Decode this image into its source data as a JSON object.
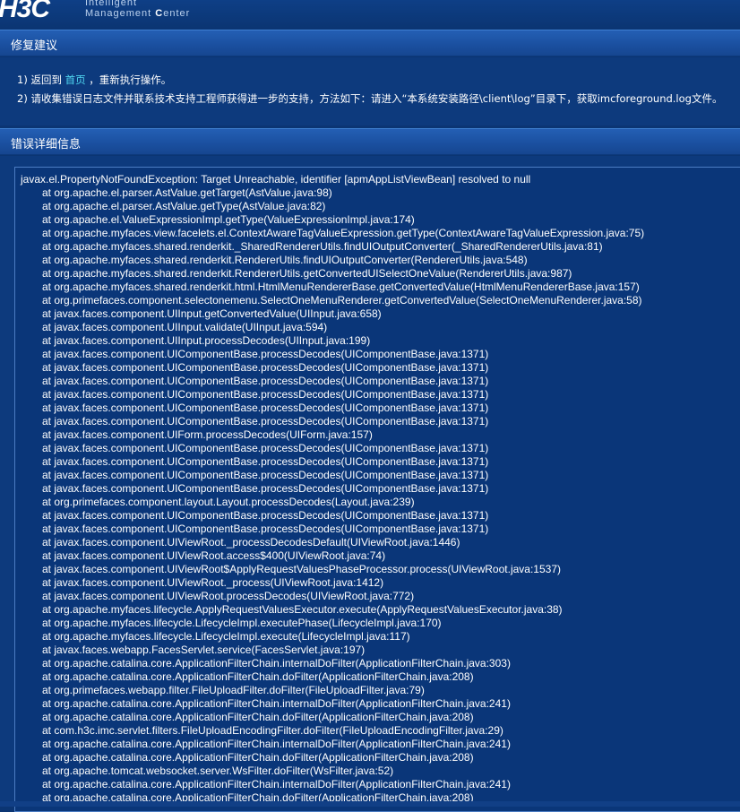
{
  "header": {
    "logo": "H3C",
    "product_line1": "Intelligent",
    "product_line2_prefix": "Management ",
    "product_line2_accent": "C",
    "product_line2_suffix": "enter"
  },
  "suggestion": {
    "title": "修复建议",
    "item1_prefix": "1)   返回到 ",
    "item1_link": "首页",
    "item1_suffix": " ，重新执行操作。",
    "item2": "2)   请收集错误日志文件并联系技术支持工程师获得进一步的支持，方法如下：请进入“本系统安装路径\\client\\log”目录下，获取imcforeground.log文件。"
  },
  "detail": {
    "title": "错误详细信息",
    "exception": "javax.el.PropertyNotFoundException: Target Unreachable, identifier [apmAppListViewBean] resolved to null",
    "frames": [
      "at org.apache.el.parser.AstValue.getTarget(AstValue.java:98)",
      "at org.apache.el.parser.AstValue.getType(AstValue.java:82)",
      "at org.apache.el.ValueExpressionImpl.getType(ValueExpressionImpl.java:174)",
      "at org.apache.myfaces.view.facelets.el.ContextAwareTagValueExpression.getType(ContextAwareTagValueExpression.java:75)",
      "at org.apache.myfaces.shared.renderkit._SharedRendererUtils.findUIOutputConverter(_SharedRendererUtils.java:81)",
      "at org.apache.myfaces.shared.renderkit.RendererUtils.findUIOutputConverter(RendererUtils.java:548)",
      "at org.apache.myfaces.shared.renderkit.RendererUtils.getConvertedUISelectOneValue(RendererUtils.java:987)",
      "at org.apache.myfaces.shared.renderkit.html.HtmlMenuRendererBase.getConvertedValue(HtmlMenuRendererBase.java:157)",
      "at org.primefaces.component.selectonemenu.SelectOneMenuRenderer.getConvertedValue(SelectOneMenuRenderer.java:58)",
      "at javax.faces.component.UIInput.getConvertedValue(UIInput.java:658)",
      "at javax.faces.component.UIInput.validate(UIInput.java:594)",
      "at javax.faces.component.UIInput.processDecodes(UIInput.java:199)",
      "at javax.faces.component.UIComponentBase.processDecodes(UIComponentBase.java:1371)",
      "at javax.faces.component.UIComponentBase.processDecodes(UIComponentBase.java:1371)",
      "at javax.faces.component.UIComponentBase.processDecodes(UIComponentBase.java:1371)",
      "at javax.faces.component.UIComponentBase.processDecodes(UIComponentBase.java:1371)",
      "at javax.faces.component.UIComponentBase.processDecodes(UIComponentBase.java:1371)",
      "at javax.faces.component.UIComponentBase.processDecodes(UIComponentBase.java:1371)",
      "at javax.faces.component.UIForm.processDecodes(UIForm.java:157)",
      "at javax.faces.component.UIComponentBase.processDecodes(UIComponentBase.java:1371)",
      "at javax.faces.component.UIComponentBase.processDecodes(UIComponentBase.java:1371)",
      "at javax.faces.component.UIComponentBase.processDecodes(UIComponentBase.java:1371)",
      "at javax.faces.component.UIComponentBase.processDecodes(UIComponentBase.java:1371)",
      "at org.primefaces.component.layout.Layout.processDecodes(Layout.java:239)",
      "at javax.faces.component.UIComponentBase.processDecodes(UIComponentBase.java:1371)",
      "at javax.faces.component.UIComponentBase.processDecodes(UIComponentBase.java:1371)",
      "at javax.faces.component.UIViewRoot._processDecodesDefault(UIViewRoot.java:1446)",
      "at javax.faces.component.UIViewRoot.access$400(UIViewRoot.java:74)",
      "at javax.faces.component.UIViewRoot$ApplyRequestValuesPhaseProcessor.process(UIViewRoot.java:1537)",
      "at javax.faces.component.UIViewRoot._process(UIViewRoot.java:1412)",
      "at javax.faces.component.UIViewRoot.processDecodes(UIViewRoot.java:772)",
      "at org.apache.myfaces.lifecycle.ApplyRequestValuesExecutor.execute(ApplyRequestValuesExecutor.java:38)",
      "at org.apache.myfaces.lifecycle.LifecycleImpl.executePhase(LifecycleImpl.java:170)",
      "at org.apache.myfaces.lifecycle.LifecycleImpl.execute(LifecycleImpl.java:117)",
      "at javax.faces.webapp.FacesServlet.service(FacesServlet.java:197)",
      "at org.apache.catalina.core.ApplicationFilterChain.internalDoFilter(ApplicationFilterChain.java:303)",
      "at org.apache.catalina.core.ApplicationFilterChain.doFilter(ApplicationFilterChain.java:208)",
      "at org.primefaces.webapp.filter.FileUploadFilter.doFilter(FileUploadFilter.java:79)",
      "at org.apache.catalina.core.ApplicationFilterChain.internalDoFilter(ApplicationFilterChain.java:241)",
      "at org.apache.catalina.core.ApplicationFilterChain.doFilter(ApplicationFilterChain.java:208)",
      "at com.h3c.imc.servlet.filters.FileUploadEncodingFilter.doFilter(FileUploadEncodingFilter.java:29)",
      "at org.apache.catalina.core.ApplicationFilterChain.internalDoFilter(ApplicationFilterChain.java:241)",
      "at org.apache.catalina.core.ApplicationFilterChain.doFilter(ApplicationFilterChain.java:208)",
      "at org.apache.tomcat.websocket.server.WsFilter.doFilter(WsFilter.java:52)",
      "at org.apache.catalina.core.ApplicationFilterChain.internalDoFilter(ApplicationFilterChain.java:241)",
      "at org.apache.catalina.core.ApplicationFilterChain.doFilter(ApplicationFilterChain.java:208)"
    ]
  }
}
